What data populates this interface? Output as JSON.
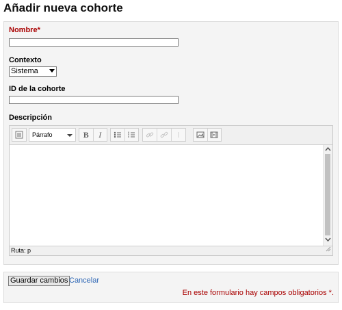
{
  "page": {
    "title": "Añadir nueva cohorte"
  },
  "form": {
    "name": {
      "label": "Nombre",
      "required_marker": "*",
      "value": ""
    },
    "context": {
      "label": "Contexto",
      "selected": "Sistema"
    },
    "idnumber": {
      "label": "ID de la cohorte",
      "value": ""
    },
    "description": {
      "label": "Descripción"
    }
  },
  "editor": {
    "format_select": "Párrafo",
    "toolbar_icons": [
      "toggle-toolbar-icon",
      "bold-icon",
      "italic-icon",
      "unordered-list-icon",
      "ordered-list-icon",
      "link-icon",
      "unlink-icon",
      "anchor-icon",
      "image-icon",
      "media-icon"
    ],
    "bold_glyph": "B",
    "italic_glyph": "I",
    "path_label": "Ruta: p"
  },
  "footer": {
    "save_label": "Guardar cambios",
    "cancel_label": "Cancelar",
    "required_note": "En este formulario hay campos obligatorios",
    "required_marker": "*",
    "required_end": "."
  },
  "colors": {
    "required": "#a90000",
    "link": "#2a64b4",
    "panel": "#f4f4f4"
  }
}
